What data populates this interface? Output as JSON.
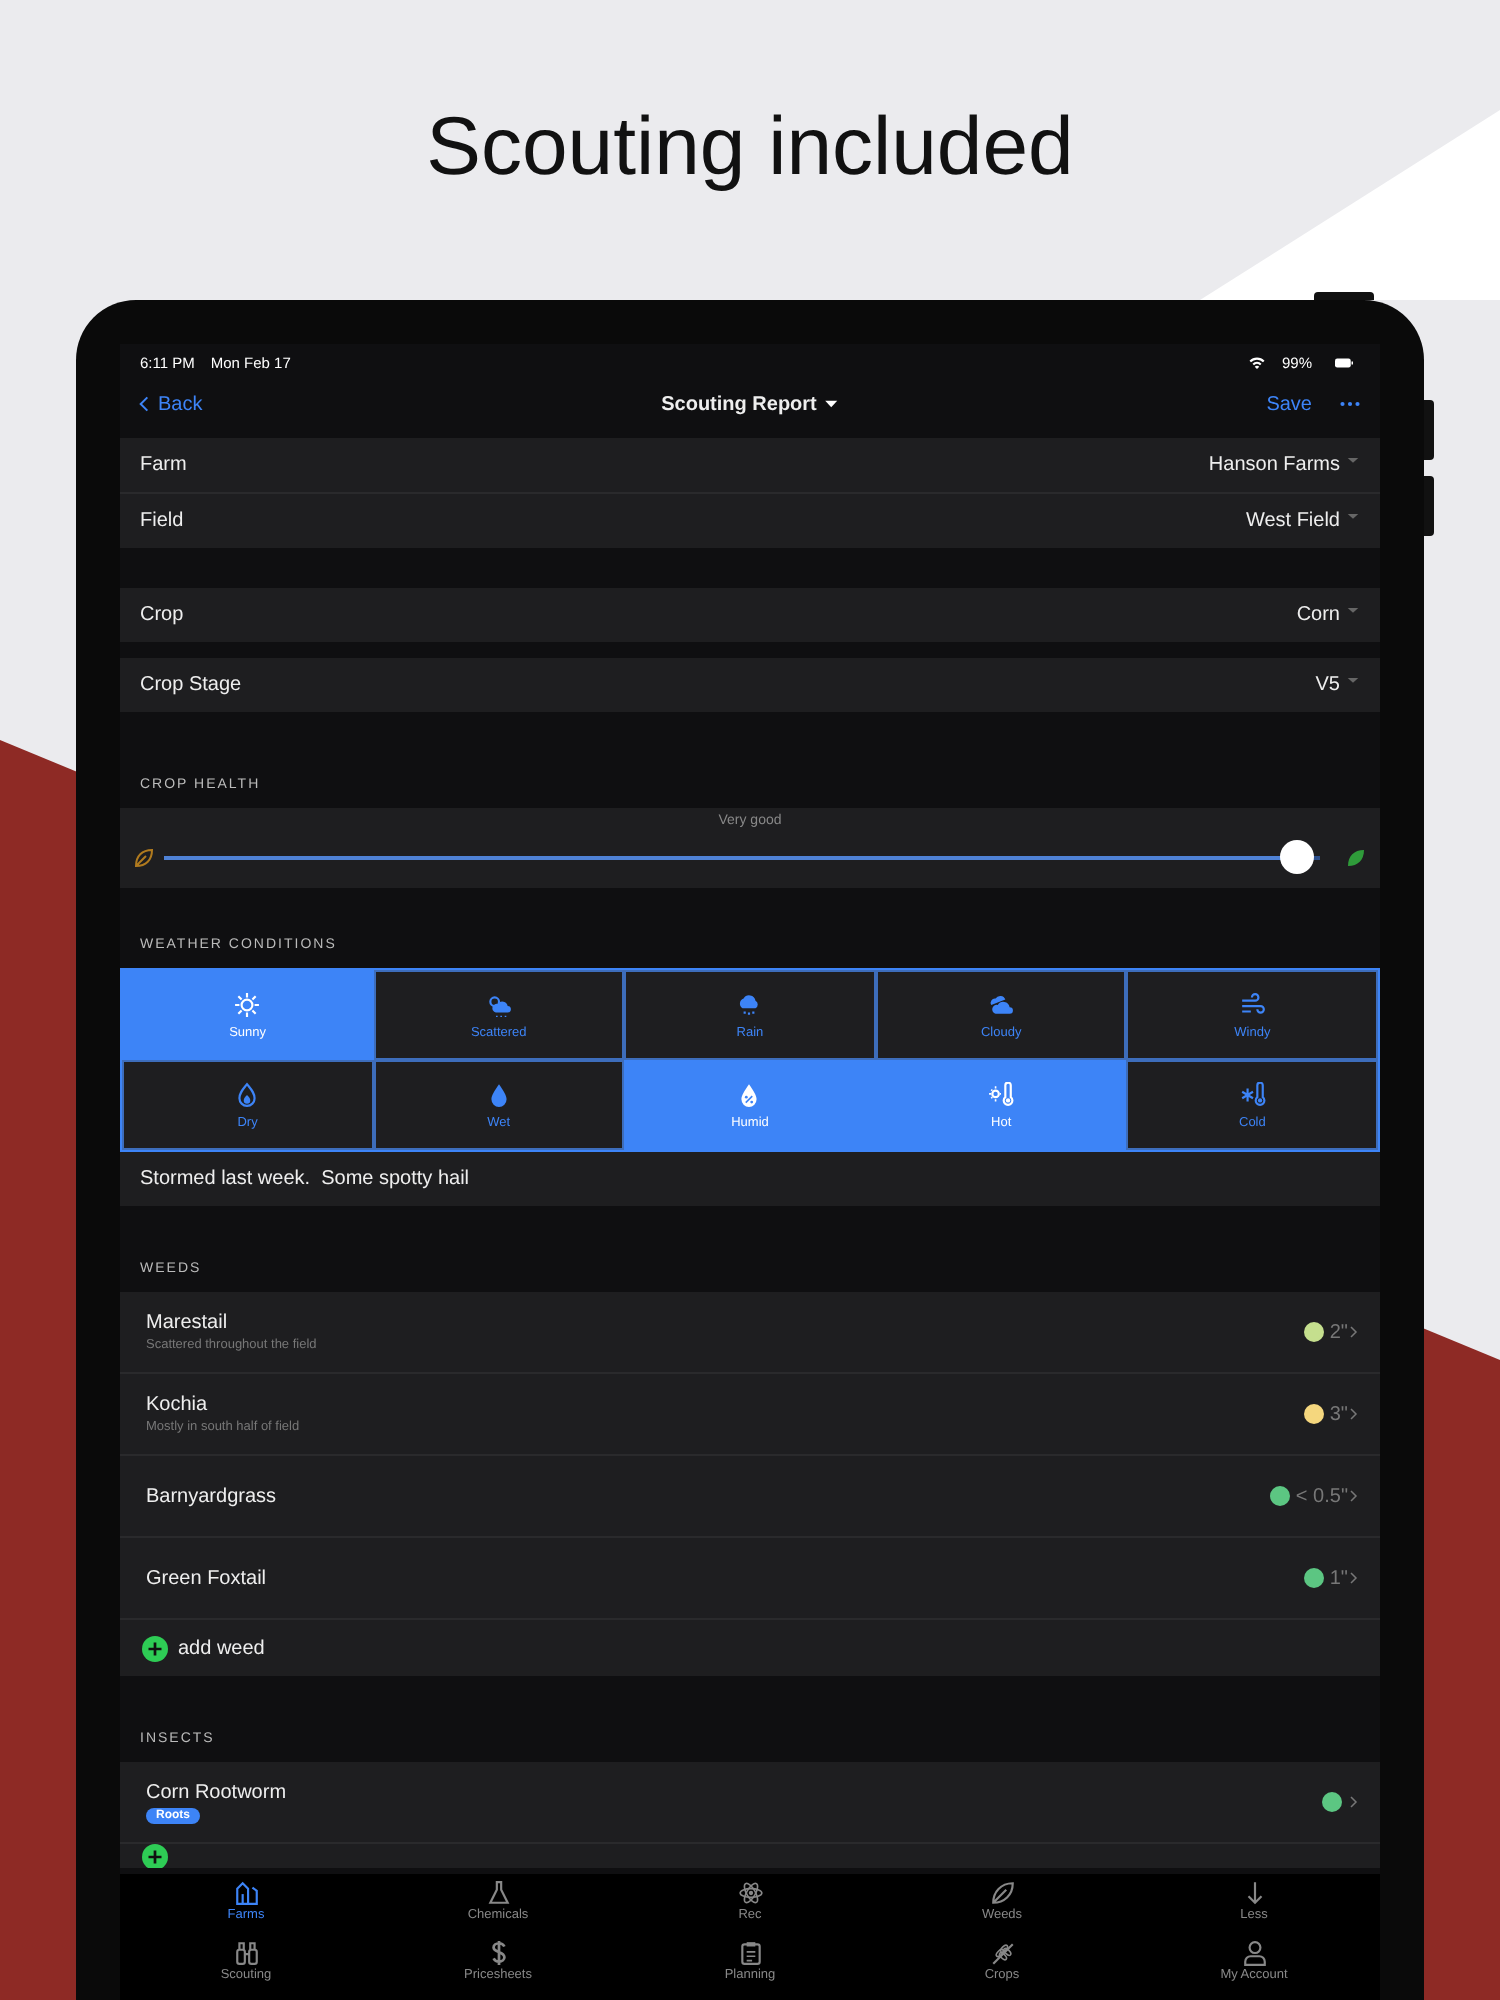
{
  "headline": "Scouting included",
  "status_bar": {
    "time": "6:11 PM",
    "date": "Mon Feb 17",
    "battery": "99%"
  },
  "nav": {
    "back": "Back",
    "title": "Scouting Report",
    "save": "Save"
  },
  "field_groups": [
    [
      {
        "label": "Farm",
        "value": "Hanson Farms"
      },
      {
        "label": "Field",
        "value": "West Field"
      }
    ],
    [
      {
        "label": "Crop",
        "value": "Corn"
      }
    ],
    [
      {
        "label": "Crop Stage",
        "value": "V5"
      }
    ]
  ],
  "crop_health": {
    "header": "CROP HEALTH",
    "reading": "Very good",
    "level": 0.98
  },
  "weather": {
    "header": "WEATHER CONDITIONS",
    "notes": "Stormed last week.  Some spotty hail",
    "conditions": [
      {
        "label": "Sunny",
        "selected": true
      },
      {
        "label": "Scattered",
        "selected": false
      },
      {
        "label": "Rain",
        "selected": false
      },
      {
        "label": "Cloudy",
        "selected": false
      },
      {
        "label": "Windy",
        "selected": false
      },
      {
        "label": "Dry",
        "selected": false
      },
      {
        "label": "Wet",
        "selected": false
      },
      {
        "label": "Humid",
        "selected": true
      },
      {
        "label": "Hot",
        "selected": true
      },
      {
        "label": "Cold",
        "selected": false
      }
    ]
  },
  "weeds": {
    "header": "WEEDS",
    "add": "add weed",
    "items": [
      {
        "name": "Marestail",
        "note": "Scattered throughout the field",
        "color": "#c5df8e",
        "size": "2\""
      },
      {
        "name": "Kochia",
        "note": "Mostly in south half of field",
        "color": "#f5d77e",
        "size": "3\""
      },
      {
        "name": "Barnyardgrass",
        "color": "#5cc682",
        "size": "< 0.5\""
      },
      {
        "name": "Green Foxtail",
        "color": "#5cc682",
        "size": "1\""
      }
    ]
  },
  "insects": {
    "header": "INSECTS",
    "items": [
      {
        "name": "Corn Rootworm",
        "tag": "Roots",
        "color": "#5cc682"
      }
    ]
  },
  "tab_bar": [
    {
      "label": "Farms",
      "selected": true
    },
    {
      "label": "Chemicals",
      "selected": false
    },
    {
      "label": "Rec",
      "selected": false
    },
    {
      "label": "Weeds",
      "selected": false
    },
    {
      "label": "Less",
      "selected": false
    },
    {
      "label": "Scouting",
      "selected": false
    },
    {
      "label": "Pricesheets",
      "selected": false
    },
    {
      "label": "Planning",
      "selected": false
    },
    {
      "label": "Crops",
      "selected": false
    },
    {
      "label": "My Account",
      "selected": false
    }
  ]
}
